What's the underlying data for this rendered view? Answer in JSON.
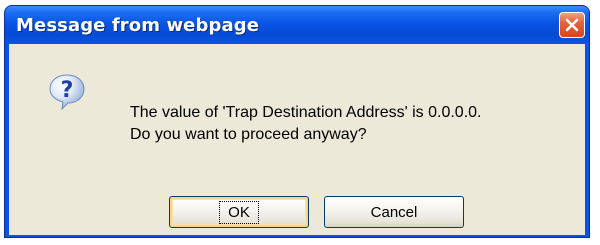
{
  "window": {
    "title": "Message from webpage",
    "close_icon": "close-icon"
  },
  "message": {
    "icon": "question-icon",
    "line1": "The value of 'Trap Destination Address' is 0.0.0.0.",
    "line2": "Do you want to proceed anyway?"
  },
  "buttons": {
    "ok_label": "OK",
    "cancel_label": "Cancel"
  },
  "colors": {
    "titlebar": "#0a55e6",
    "client": "#ece9d8",
    "close": "#d8431f"
  }
}
